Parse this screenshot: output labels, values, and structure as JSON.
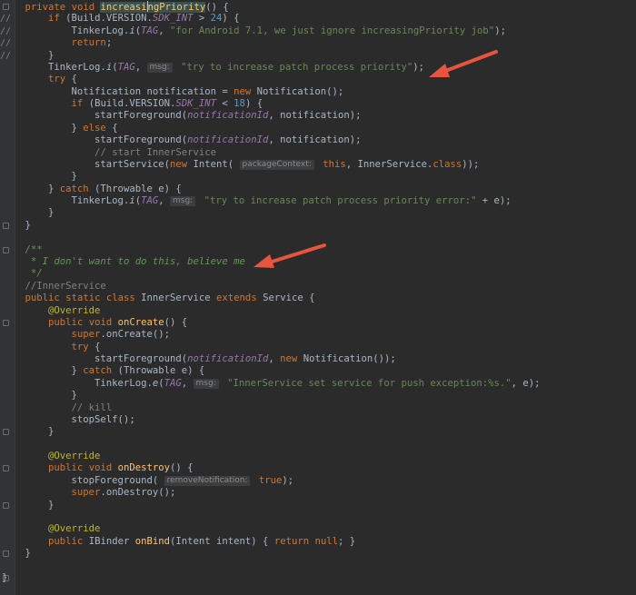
{
  "editor": {
    "lines": [
      {
        "g": "",
        "fold": true,
        "t": "    private void increasingPriority() {"
      },
      {
        "g": "//",
        "t": "        if (Build.VERSION.SDK_INT > 24) {"
      },
      {
        "g": "//",
        "t": "            TinkerLog.i(TAG, \"for Android 7.1, we just ignore increasingPriority job\");"
      },
      {
        "g": "//",
        "t": "            return;"
      },
      {
        "g": "//",
        "t": "        }"
      },
      {
        "g": "",
        "t": "        TinkerLog.i(TAG,  msg: \"try to increase patch process priority\");"
      },
      {
        "g": "",
        "t": "        try {"
      },
      {
        "g": "",
        "t": "            Notification notification = new Notification();"
      },
      {
        "g": "",
        "t": "            if (Build.VERSION.SDK_INT < 18) {"
      },
      {
        "g": "",
        "t": "                startForeground(notificationId, notification);"
      },
      {
        "g": "",
        "t": "            } else {"
      },
      {
        "g": "",
        "t": "                startForeground(notificationId, notification);"
      },
      {
        "g": "",
        "t": "                // start InnerService"
      },
      {
        "g": "",
        "t": "                startService(new Intent( packageContext: this, InnerService.class));"
      },
      {
        "g": "",
        "t": "            }"
      },
      {
        "g": "",
        "t": "        } catch (Throwable e) {"
      },
      {
        "g": "",
        "t": "            TinkerLog.i(TAG,  msg: \"try to increase patch process priority error:\" + e);"
      },
      {
        "g": "",
        "t": "        }"
      },
      {
        "g": "",
        "fold": true,
        "t": "    }"
      },
      {
        "g": "",
        "t": ""
      },
      {
        "g": "",
        "fold": true,
        "t": "    /**"
      },
      {
        "g": "",
        "t": "     * I don't want to do this, believe me"
      },
      {
        "g": "",
        "t": "     */"
      },
      {
        "g": "",
        "t": "    //InnerService"
      },
      {
        "g": "",
        "t": "    public static class InnerService extends Service {"
      },
      {
        "g": "",
        "t": "        @Override"
      },
      {
        "g": "",
        "fold": true,
        "t": "        public void onCreate() {"
      },
      {
        "g": "",
        "t": "            super.onCreate();"
      },
      {
        "g": "",
        "t": "            try {"
      },
      {
        "g": "",
        "t": "                startForeground(notificationId, new Notification());"
      },
      {
        "g": "",
        "t": "            } catch (Throwable e) {"
      },
      {
        "g": "",
        "t": "                TinkerLog.e(TAG,  msg: \"InnerService set service for push exception:%s.\", e);"
      },
      {
        "g": "",
        "t": "            }"
      },
      {
        "g": "",
        "t": "            // kill"
      },
      {
        "g": "",
        "t": "            stopSelf();"
      },
      {
        "g": "",
        "fold": true,
        "t": "        }"
      },
      {
        "g": "",
        "t": ""
      },
      {
        "g": "",
        "t": "        @Override"
      },
      {
        "g": "",
        "fold": true,
        "t": "        public void onDestroy() {"
      },
      {
        "g": "",
        "t": "            stopForeground( removeNotification: true);"
      },
      {
        "g": "",
        "t": "            super.onDestroy();"
      },
      {
        "g": "",
        "fold": true,
        "t": "        }"
      },
      {
        "g": "",
        "t": ""
      },
      {
        "g": "",
        "t": "        @Override"
      },
      {
        "g": "",
        "t": "        public IBinder onBind(Intent intent) { return null; }"
      },
      {
        "g": "",
        "fold": true,
        "t": "    }"
      },
      {
        "g": "",
        "t": ""
      },
      {
        "g": "",
        "fold": true,
        "t": "}"
      }
    ]
  },
  "colors": {
    "background": "#2b2b2b",
    "gutter": "#313335",
    "arrow": "#e8553e",
    "keyword": "#cc7832",
    "method": "#ffc66d",
    "string": "#6a8759",
    "comment": "#808080",
    "doc_comment": "#629755",
    "field": "#9876aa",
    "annotation": "#bbb529",
    "number": "#6897bb",
    "text": "#a9b7c6"
  },
  "annotations": [
    {
      "name": "arrow-1",
      "icon": "red-arrow-icon"
    },
    {
      "name": "arrow-2",
      "icon": "red-arrow-icon"
    }
  ]
}
